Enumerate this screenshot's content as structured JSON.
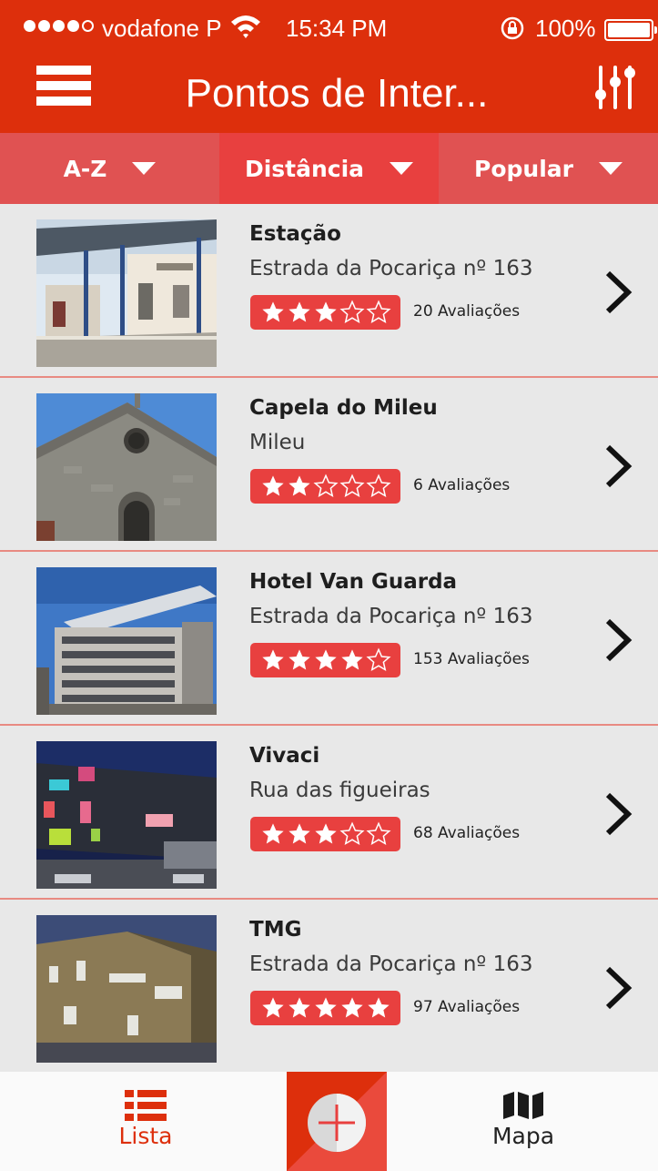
{
  "status_bar": {
    "carrier": "vodafone P",
    "time": "15:34 PM",
    "battery": "100%"
  },
  "nav": {
    "title": "Pontos de Inter..."
  },
  "sort_tabs": [
    {
      "label": "A-Z"
    },
    {
      "label": "Distância"
    },
    {
      "label": "Popular"
    }
  ],
  "items": [
    {
      "name": "Estação",
      "address": "Estrada da Pocariça nº 163",
      "rating": 3,
      "reviews": "20 Avaliações"
    },
    {
      "name": "Capela do Mileu",
      "address": "Mileu",
      "rating": 2,
      "reviews": "6 Avaliações"
    },
    {
      "name": "Hotel Van Guarda",
      "address": "Estrada da Pocariça nº 163",
      "rating": 4,
      "reviews": "153 Avaliações"
    },
    {
      "name": "Vivaci",
      "address": "Rua das figueiras",
      "rating": 3,
      "reviews": "68 Avaliações"
    },
    {
      "name": "TMG",
      "address": "Estrada da Pocariça nº 163",
      "rating": 5,
      "reviews": "97 Avaliações"
    }
  ],
  "tab_bar": {
    "list_label": "Lista",
    "map_label": "Mapa"
  },
  "colors": {
    "brand": "#dd2f0c",
    "accent": "#e8403f",
    "sort_bg": "#e05252"
  }
}
